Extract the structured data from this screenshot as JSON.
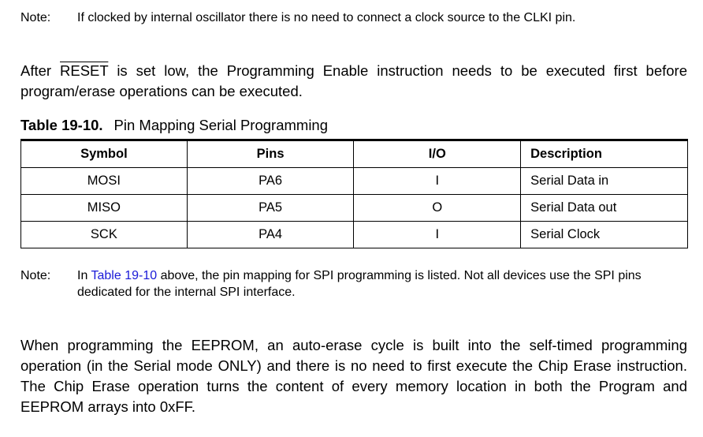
{
  "note1": {
    "label": "Note:",
    "text": "If clocked by internal oscillator there is no need to connect a clock source to the CLKI pin."
  },
  "para1": {
    "before": "After ",
    "overlined": "RESET",
    "after": " is set low, the Programming Enable instruction needs to be executed first before program/erase operations can be executed."
  },
  "table": {
    "caption_number": "Table 19-10.",
    "caption_title": "Pin Mapping Serial Programming",
    "headers": [
      "Symbol",
      "Pins",
      "I/O",
      "Description"
    ],
    "rows": [
      [
        "MOSI",
        "PA6",
        "I",
        "Serial Data in"
      ],
      [
        "MISO",
        "PA5",
        "O",
        "Serial Data out"
      ],
      [
        "SCK",
        "PA4",
        "I",
        "Serial Clock"
      ]
    ]
  },
  "note2": {
    "label": "Note:",
    "before": "In ",
    "link": "Table 19-10",
    "after": " above, the pin mapping for SPI programming is listed. Not all devices use the SPI pins dedicated for the internal SPI interface."
  },
  "para2": {
    "text": "When programming the EEPROM, an auto-erase cycle is built into the self-timed programming operation (in the Serial mode ONLY) and there is no need to first execute the Chip Erase instruction. The Chip Erase operation turns the content of every memory location in both the Program and EEPROM arrays into 0xFF."
  },
  "colors": {
    "link": "#1a1ad8"
  }
}
